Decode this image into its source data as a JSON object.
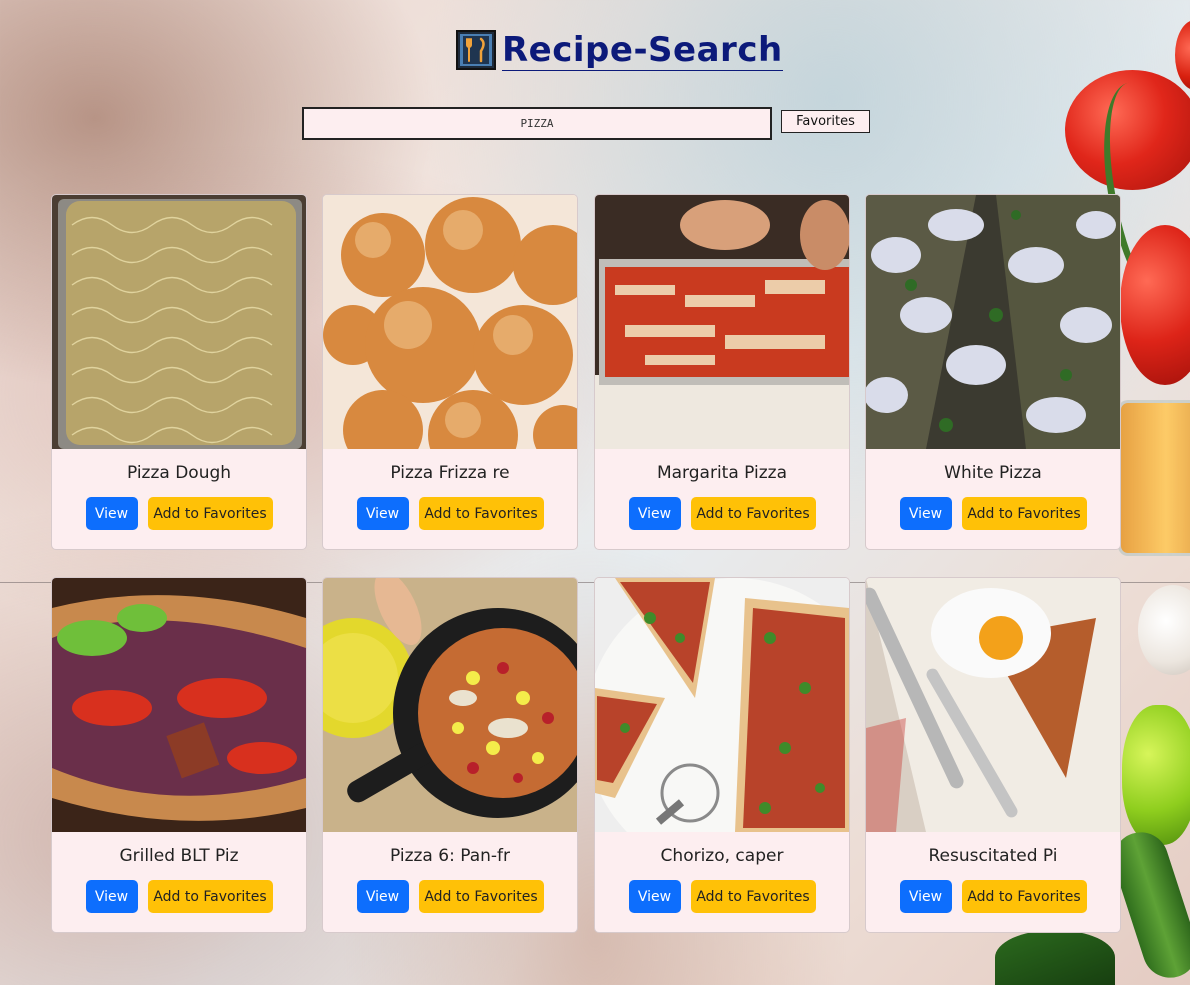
{
  "header": {
    "title": "Recipe-Search",
    "logo_icon": "utensils-icon"
  },
  "search": {
    "value": "PIZZA",
    "placeholder": ""
  },
  "nav": {
    "favorites_label": "Favorites"
  },
  "colors": {
    "view_button": "#0d6efd",
    "favorite_button": "#ffc107",
    "card_bg": "#fdeef0",
    "title": "#0c1a7a"
  },
  "cards": [
    {
      "title": "Pizza Dough",
      "view_label": "View",
      "fav_label": "Add to Favorites"
    },
    {
      "title": "Pizza Frizza re",
      "view_label": "View",
      "fav_label": "Add to Favorites"
    },
    {
      "title": "Margarita Pizza",
      "view_label": "View",
      "fav_label": "Add to Favorites"
    },
    {
      "title": "White Pizza",
      "view_label": "View",
      "fav_label": "Add to Favorites"
    },
    {
      "title": "Grilled BLT Piz",
      "view_label": "View",
      "fav_label": "Add to Favorites"
    },
    {
      "title": "Pizza 6: Pan-fr",
      "view_label": "View",
      "fav_label": "Add to Favorites"
    },
    {
      "title": "Chorizo, caper",
      "view_label": "View",
      "fav_label": "Add to Favorites"
    },
    {
      "title": "Resuscitated Pi",
      "view_label": "View",
      "fav_label": "Add to Favorites"
    }
  ]
}
